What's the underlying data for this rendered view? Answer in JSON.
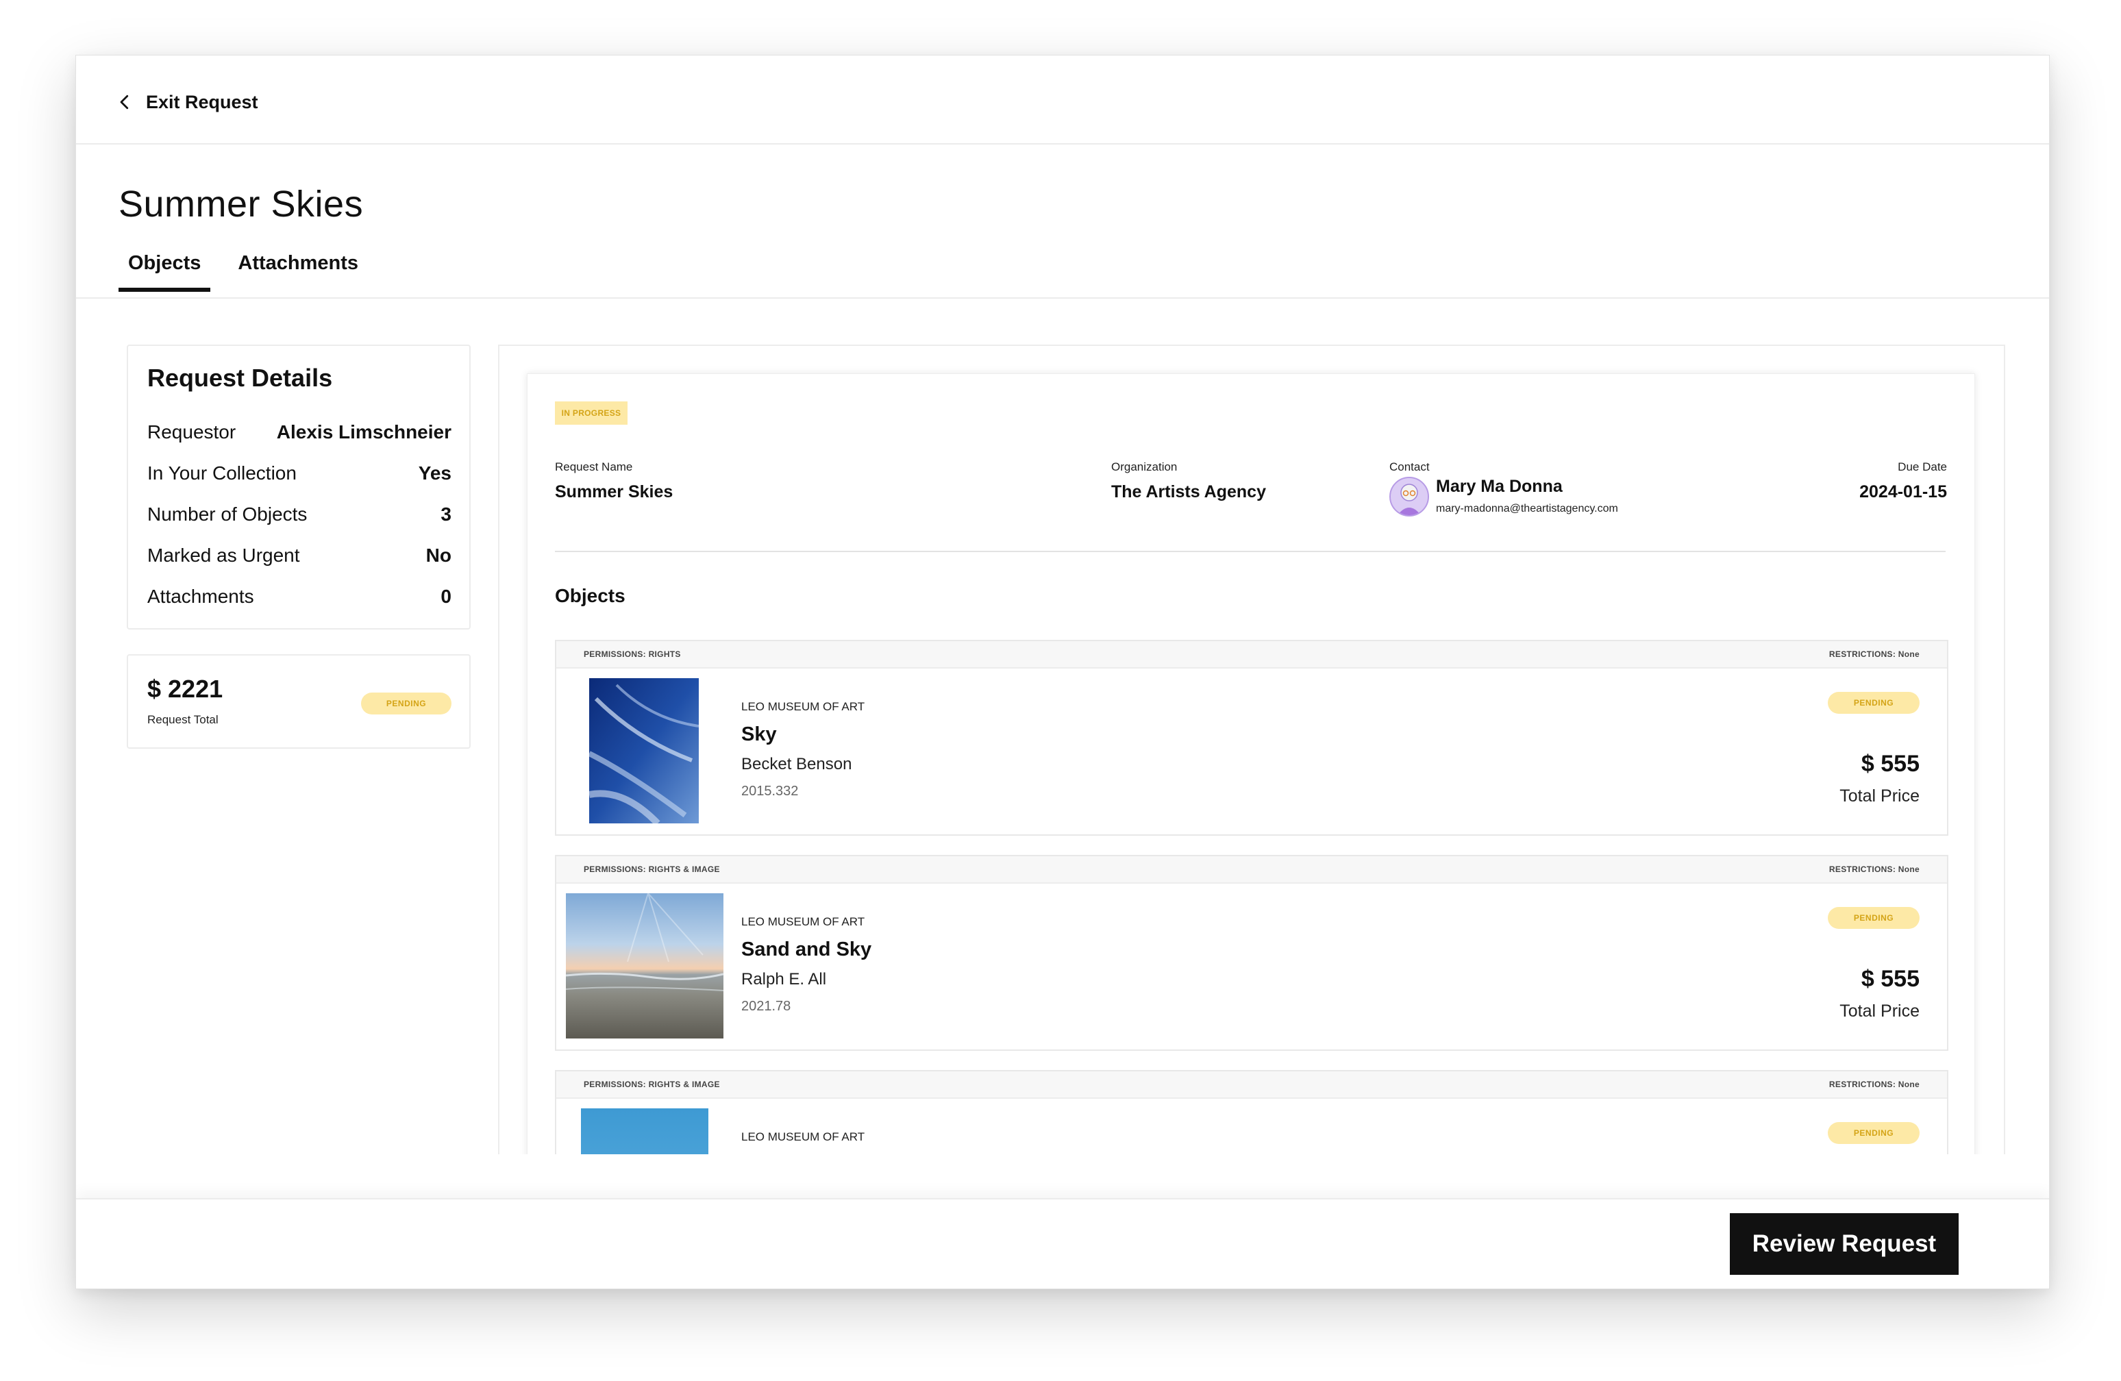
{
  "header": {
    "exit_label": "Exit Request"
  },
  "page": {
    "title": "Summer Skies"
  },
  "tabs": [
    {
      "label": "Objects",
      "active": true
    },
    {
      "label": "Attachments",
      "active": false
    }
  ],
  "details": {
    "heading": "Request Details",
    "rows": [
      {
        "label": "Requestor",
        "value": "Alexis Limschneier"
      },
      {
        "label": "In Your Collection",
        "value": "Yes"
      },
      {
        "label": "Number of Objects",
        "value": "3"
      },
      {
        "label": "Marked as Urgent",
        "value": "No"
      },
      {
        "label": "Attachments",
        "value": "0"
      }
    ]
  },
  "total": {
    "amount": "$ 2221",
    "label": "Request Total",
    "status": "PENDING"
  },
  "request": {
    "status": "IN PROGRESS",
    "name_label": "Request Name",
    "name": "Summer Skies",
    "org_label": "Organization",
    "org": "The Artists Agency",
    "contact_label": "Contact",
    "contact_name": "Mary Ma Donna",
    "contact_email": "mary-madonna@theartistagency.com",
    "due_label": "Due Date",
    "due": "2024-01-15"
  },
  "objects_heading": "Objects",
  "objects": [
    {
      "permissions": "PERMISSIONS: RIGHTS",
      "restrictions": "RESTRICTIONS: None",
      "museum": "LEO MUSEUM OF ART",
      "title": "Sky",
      "artist": "Becket Benson",
      "accession": "2015.332",
      "status": "PENDING",
      "price": "$ 555",
      "price_label": "Total Price"
    },
    {
      "permissions": "PERMISSIONS: RIGHTS & IMAGE",
      "restrictions": "RESTRICTIONS: None",
      "museum": "LEO MUSEUM OF ART",
      "title": "Sand and Sky",
      "artist": "Ralph E. All",
      "accession": "2021.78",
      "status": "PENDING",
      "price": "$ 555",
      "price_label": "Total Price"
    },
    {
      "permissions": "PERMISSIONS: RIGHTS & IMAGE",
      "restrictions": "RESTRICTIONS: None",
      "museum": "LEO MUSEUM OF ART",
      "status": "PENDING"
    }
  ],
  "footer": {
    "review_label": "Review Request"
  },
  "colors": {
    "accent": "#111111",
    "pending_bg": "#fde9a6",
    "pending_text": "#d4a417"
  }
}
